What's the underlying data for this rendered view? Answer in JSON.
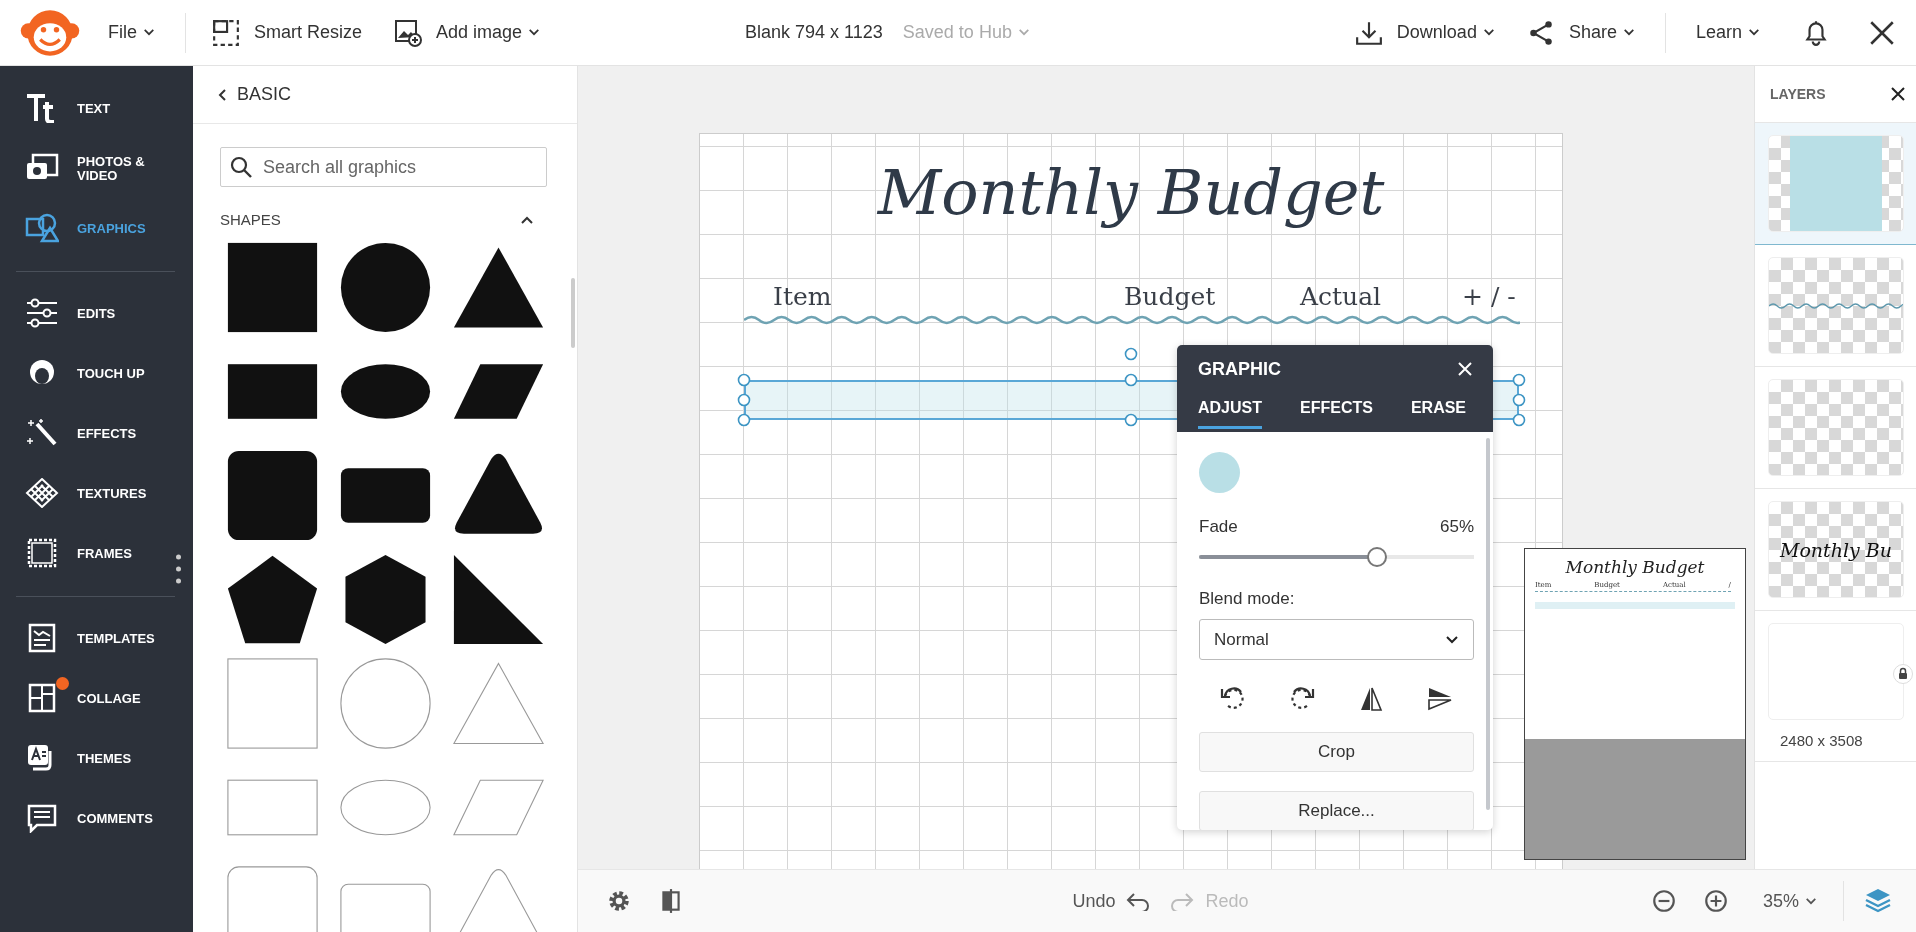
{
  "header": {
    "file": "File",
    "smart_resize": "Smart Resize",
    "add_image": "Add image",
    "doc_title": "Blank 794 x 1123",
    "save_status": "Saved to Hub",
    "download": "Download",
    "share": "Share",
    "learn": "Learn"
  },
  "nav_groups": [
    [
      {
        "kind": "text",
        "label": "TEXT",
        "selected": false,
        "dot": false
      },
      {
        "kind": "photos",
        "label": "PHOTOS & VIDEO",
        "selected": false,
        "dot": false
      },
      {
        "kind": "graphics",
        "label": "GRAPHICS",
        "selected": true,
        "dot": false
      }
    ],
    [
      {
        "kind": "edits",
        "label": "EDITS",
        "selected": false,
        "dot": false
      },
      {
        "kind": "touchup",
        "label": "TOUCH UP",
        "selected": false,
        "dot": false
      },
      {
        "kind": "effects",
        "label": "EFFECTS",
        "selected": false,
        "dot": false
      },
      {
        "kind": "textures",
        "label": "TEXTURES",
        "selected": false,
        "dot": false
      },
      {
        "kind": "frames",
        "label": "FRAMES",
        "selected": false,
        "dot": false
      }
    ],
    [
      {
        "kind": "templates",
        "label": "TEMPLATES",
        "selected": false,
        "dot": false
      },
      {
        "kind": "collage",
        "label": "COLLAGE",
        "selected": false,
        "dot": true
      },
      {
        "kind": "themes",
        "label": "THEMES",
        "selected": false,
        "dot": false
      },
      {
        "kind": "comments",
        "label": "COMMENTS",
        "selected": false,
        "dot": false
      }
    ]
  ],
  "panel": {
    "back": "BASIC",
    "search": {
      "placeholder": "Search all graphics"
    },
    "section": "SHAPES",
    "expanded": true,
    "shapes": [
      {
        "kind": "square",
        "filled": true
      },
      {
        "kind": "circle",
        "filled": true
      },
      {
        "kind": "triangle",
        "filled": true
      },
      {
        "kind": "rect",
        "filled": true
      },
      {
        "kind": "ellipse",
        "filled": true
      },
      {
        "kind": "parallelogram",
        "filled": true
      },
      {
        "kind": "rounded-square",
        "filled": true
      },
      {
        "kind": "rounded-rect",
        "filled": true
      },
      {
        "kind": "rounded-triangle",
        "filled": true
      },
      {
        "kind": "pentagon",
        "filled": true
      },
      {
        "kind": "hexagon",
        "filled": true
      },
      {
        "kind": "right-triangle",
        "filled": true
      },
      {
        "kind": "square",
        "filled": false
      },
      {
        "kind": "circle",
        "filled": false
      },
      {
        "kind": "triangle",
        "filled": false
      },
      {
        "kind": "rect",
        "filled": false
      },
      {
        "kind": "ellipse",
        "filled": false
      },
      {
        "kind": "parallelogram",
        "filled": false
      },
      {
        "kind": "rounded-square",
        "filled": false
      },
      {
        "kind": "rounded-rect",
        "filled": false
      },
      {
        "kind": "rounded-triangle",
        "filled": false
      }
    ]
  },
  "document": {
    "title": "Monthly Budget",
    "columns": [
      "Item",
      "Budget",
      "Actual",
      "+ / -"
    ]
  },
  "graphic_panel": {
    "title": "GRAPHIC",
    "tabs": [
      {
        "label": "ADJUST",
        "selected": true
      },
      {
        "label": "EFFECTS",
        "selected": false
      },
      {
        "label": "ERASE",
        "selected": false
      }
    ],
    "fade": {
      "label": "Fade",
      "reading": "65%",
      "level": 0.65
    },
    "blend_label": "Blend mode:",
    "blend_value": "Normal",
    "buttons": [
      "Crop",
      "Replace..."
    ]
  },
  "minimap": {
    "title": "Monthly Budget",
    "columns": [
      "Item",
      "Budget",
      "Actual",
      "/"
    ]
  },
  "layers": {
    "title": "LAYERS",
    "items": [
      {
        "kind": "shape",
        "selected": true
      },
      {
        "kind": "wave",
        "selected": false
      },
      {
        "kind": "empty",
        "selected": false
      },
      {
        "kind": "text",
        "selected": false,
        "text": "Monthly Bu"
      },
      {
        "kind": "background",
        "selected": false,
        "locked": true,
        "size": "2480 x 3508"
      }
    ]
  },
  "footer": {
    "undo": "Undo",
    "redo": "Redo",
    "redo_disabled": true,
    "zoom": "35%"
  }
}
